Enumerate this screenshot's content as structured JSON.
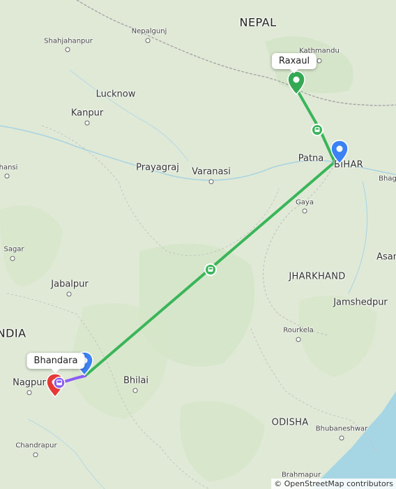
{
  "map": {
    "colors": {
      "land": "#dfe9d6",
      "forest": "#cfe0c2",
      "water": "#9fd3e3",
      "route_main": "#3bb55a",
      "route_short": "#8a5cf5",
      "pin_blue": "#3b82f6",
      "pin_green": "#34a853",
      "pin_red": "#e53935"
    },
    "labels": {
      "nepal": "NEPAL",
      "india": "INDIA",
      "bihar": "BIHAR",
      "jharkhand": "JHARKHAND",
      "odisha": "ODISHA",
      "kathmandu": "Kathmandu",
      "nepalgunj": "Nepalgunj",
      "shahjahanpur": "Shahjahanpur",
      "lucknow": "Lucknow",
      "kanpur": "Kanpur",
      "prayagraj": "Prayagraj",
      "varanasi": "Varanasi",
      "patna": "Patna",
      "gaya": "Gaya",
      "bhagalpur": "Bhag",
      "asansol": "Asan",
      "jamshedpur": "Jamshedpur",
      "rourkela": "Rourkela",
      "bhubaneshwar": "Bhubaneshwar",
      "brahmapur": "Brahmapur",
      "jhansi": "hansi",
      "sagar": "Sagar",
      "jabalpur": "Jabalpur",
      "nagpur": "Nagpur",
      "bhilai": "Bhilai",
      "chandrapur": "Chandrapur"
    },
    "callouts": {
      "raxaul": "Raxaul",
      "bhandara": "Bhandara"
    },
    "attribution": "© OpenStreetMap contributors"
  }
}
